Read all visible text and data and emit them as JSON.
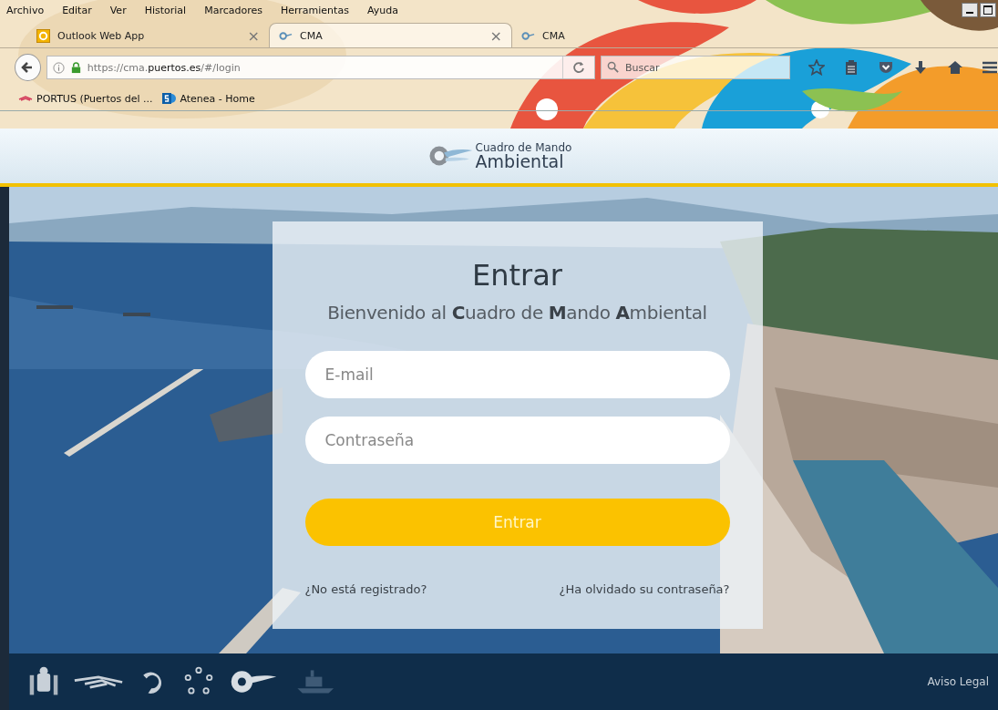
{
  "menu": [
    "Archivo",
    "Editar",
    "Ver",
    "Historial",
    "Marcadores",
    "Herramientas",
    "Ayuda"
  ],
  "tabs": [
    {
      "title": "Outlook Web App",
      "selected": false,
      "close": "×"
    },
    {
      "title": "CMA",
      "selected": true,
      "close": "×"
    },
    {
      "title": "CMA",
      "selected": false
    }
  ],
  "address": {
    "url": "https://cma.**puertos.es**/#/login"
  },
  "search": {
    "placeholder": "Buscar"
  },
  "bookmarks": [
    {
      "title": "PORTUS (Puertos del ..."
    },
    {
      "title": "Atenea - Home"
    }
  ],
  "header": {
    "logo_top": "Cuadro de Mando",
    "logo_bottom": "Ambiental"
  },
  "login": {
    "title": "Entrar",
    "subtitle": "Bienvenido al **C**uadro de **M**ando **A**mbiental",
    "email": {
      "placeholder": "E-mail"
    },
    "password": {
      "placeholder": "Contraseña"
    },
    "button": "Entrar",
    "register_link": "¿No está registrado?",
    "forgot_link": "¿Ha olvidado su contraseña?"
  },
  "footer": {
    "legal_link": "Aviso Legal"
  }
}
